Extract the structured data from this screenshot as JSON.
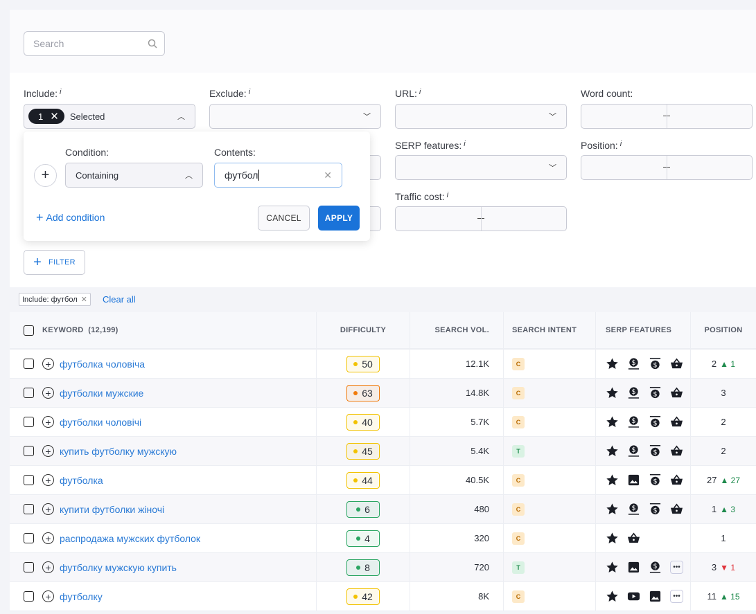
{
  "search": {
    "placeholder": "Search"
  },
  "filters": {
    "include": {
      "label": "Include:",
      "count": "1",
      "value": "Selected"
    },
    "exclude": {
      "label": "Exclude:"
    },
    "url": {
      "label": "URL:"
    },
    "word_count": {
      "label": "Word count:"
    },
    "serp_features": {
      "label": "SERP features:"
    },
    "position": {
      "label": "Position:"
    },
    "traffic_cost": {
      "label": "Traffic cost:"
    },
    "info_mark": "i",
    "filter_button": "FILTER"
  },
  "popup": {
    "condition_label": "Condition:",
    "condition_value": "Containing",
    "contents_label": "Contents:",
    "contents_value": "футбол",
    "add_condition": "Add condition",
    "cancel": "CANCEL",
    "apply": "APPLY"
  },
  "tags": {
    "active": "Include: футбол",
    "clear_all": "Clear all"
  },
  "table": {
    "headers": {
      "keyword": "KEYWORD",
      "keyword_count": "(12,199)",
      "difficulty": "DIFFICULTY",
      "search_vol": "SEARCH VOL.",
      "intent": "SEARCH INTENT",
      "serp": "SERP FEATURES",
      "position": "POSITION"
    },
    "rows": [
      {
        "keyword": "футболка чоловіча",
        "difficulty": "50",
        "diff_level": "yellow",
        "volume": "12.1K",
        "intent": "C",
        "serp": [
          "star",
          "dollar-bottom",
          "dollar-top",
          "basket"
        ],
        "position": "2",
        "change": "1",
        "dir": "up"
      },
      {
        "keyword": "футболки мужские",
        "difficulty": "63",
        "diff_level": "orange",
        "volume": "14.8K",
        "intent": "C",
        "serp": [
          "star",
          "dollar-bottom",
          "dollar-top",
          "basket"
        ],
        "position": "3",
        "change": "",
        "dir": ""
      },
      {
        "keyword": "футболки чоловічі",
        "difficulty": "40",
        "diff_level": "yellow",
        "volume": "5.7K",
        "intent": "C",
        "serp": [
          "star",
          "dollar-bottom",
          "dollar-top",
          "basket"
        ],
        "position": "2",
        "change": "",
        "dir": ""
      },
      {
        "keyword": "купить футболку мужскую",
        "difficulty": "45",
        "diff_level": "yellow",
        "volume": "5.4K",
        "intent": "T",
        "serp": [
          "star",
          "dollar-bottom",
          "dollar-top",
          "basket"
        ],
        "position": "2",
        "change": "",
        "dir": ""
      },
      {
        "keyword": "футболка",
        "difficulty": "44",
        "diff_level": "yellow",
        "volume": "40.5K",
        "intent": "C",
        "serp": [
          "star",
          "image",
          "dollar-top",
          "basket"
        ],
        "position": "27",
        "change": "27",
        "dir": "up"
      },
      {
        "keyword": "купити футболки жіночі",
        "difficulty": "6",
        "diff_level": "green",
        "volume": "480",
        "intent": "C",
        "serp": [
          "star",
          "dollar-bottom",
          "dollar-top",
          "basket"
        ],
        "position": "1",
        "change": "3",
        "dir": "up"
      },
      {
        "keyword": "распродажа мужских футболок",
        "difficulty": "4",
        "diff_level": "green",
        "volume": "320",
        "intent": "C",
        "serp": [
          "star",
          "basket"
        ],
        "position": "1",
        "change": "",
        "dir": ""
      },
      {
        "keyword": "футболку мужскую купить",
        "difficulty": "8",
        "diff_level": "green",
        "volume": "720",
        "intent": "T",
        "serp": [
          "star",
          "image",
          "dollar-bottom",
          "more"
        ],
        "position": "3",
        "change": "1",
        "dir": "down"
      },
      {
        "keyword": "футболку",
        "difficulty": "42",
        "diff_level": "yellow",
        "volume": "8K",
        "intent": "C",
        "serp": [
          "star",
          "video",
          "image",
          "more"
        ],
        "position": "11",
        "change": "15",
        "dir": "up"
      }
    ]
  },
  "colors": {
    "accent": "#1a73d9",
    "yellow": "#f2c200",
    "orange": "#f07a0a",
    "green": "#2aa562",
    "commercial_bg": "#fde9c8",
    "transactional_bg": "#d9f2e3"
  }
}
